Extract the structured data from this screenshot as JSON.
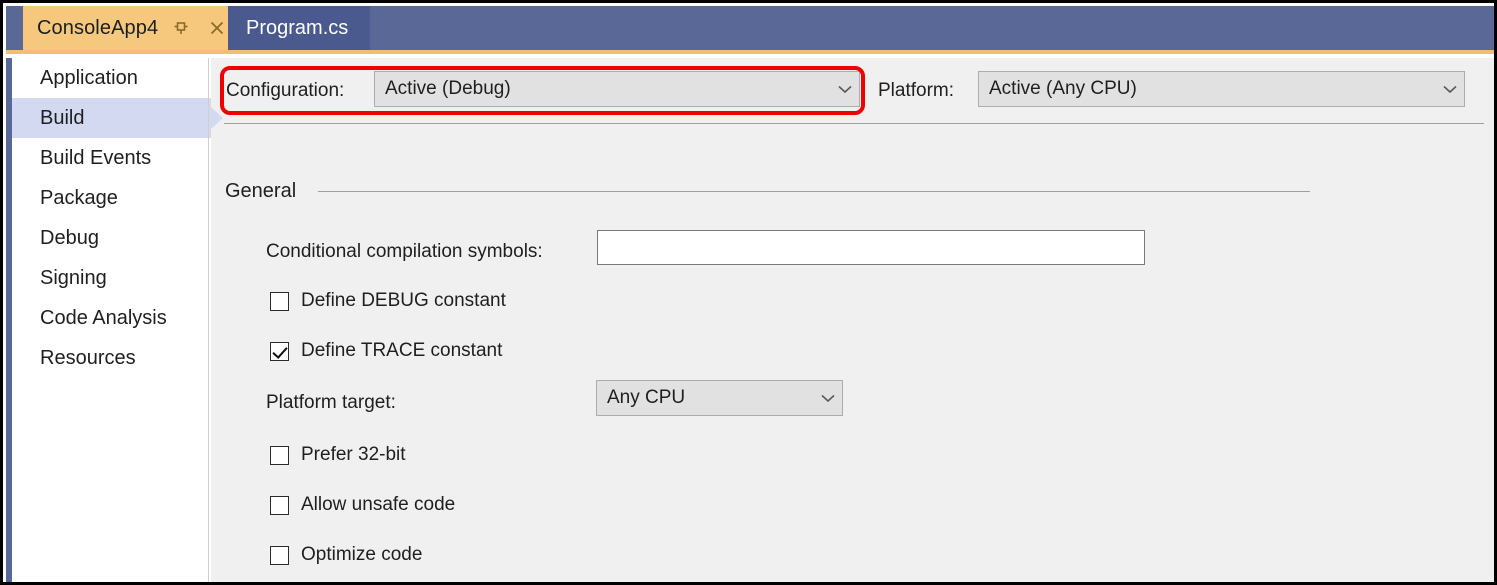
{
  "window": {
    "tabs": [
      {
        "label": "ConsoleApp4",
        "active": true,
        "pin_icon": "pin-icon",
        "close_icon": "close-icon"
      },
      {
        "label": "Program.cs",
        "active": false
      }
    ]
  },
  "sidebar": {
    "items": [
      {
        "label": "Application",
        "selected": false
      },
      {
        "label": "Build",
        "selected": true
      },
      {
        "label": "Build Events",
        "selected": false
      },
      {
        "label": "Package",
        "selected": false
      },
      {
        "label": "Debug",
        "selected": false
      },
      {
        "label": "Signing",
        "selected": false
      },
      {
        "label": "Code Analysis",
        "selected": false
      },
      {
        "label": "Resources",
        "selected": false
      }
    ]
  },
  "toolbar": {
    "configuration_label": "Configuration:",
    "configuration_value": "Active (Debug)",
    "platform_label": "Platform:",
    "platform_value": "Active (Any CPU)"
  },
  "general": {
    "section_title": "General",
    "conditional_symbols_label": "Conditional compilation symbols:",
    "conditional_symbols_value": "",
    "conditional_symbols_placeholder": "",
    "define_debug_label": "Define DEBUG constant",
    "define_debug_checked": false,
    "define_trace_label": "Define TRACE constant",
    "define_trace_checked": true,
    "platform_target_label": "Platform target:",
    "platform_target_value": "Any CPU",
    "prefer_32bit_label": "Prefer 32-bit",
    "prefer_32bit_checked": false,
    "allow_unsafe_label": "Allow unsafe code",
    "allow_unsafe_checked": false,
    "optimize_code_label": "Optimize code",
    "optimize_code_checked": false
  },
  "annotation": {
    "type": "rounded-rectangle-highlight",
    "color": "#ee0000",
    "targets": "Configuration label and dropdown"
  },
  "colors": {
    "tab_active_bg": "#f5c87e",
    "tab_inactive_bg": "#4b5a8e",
    "tabstrip_bg": "#5a6898",
    "tabstrip_underline": "#f0c070",
    "sidebar_selected_bg": "#d3d9f0",
    "sidebar_accent": "#5a6898",
    "content_bg": "#f0f0f0",
    "combo_bg": "#e1e1e1",
    "annotation": "#ee0000"
  }
}
